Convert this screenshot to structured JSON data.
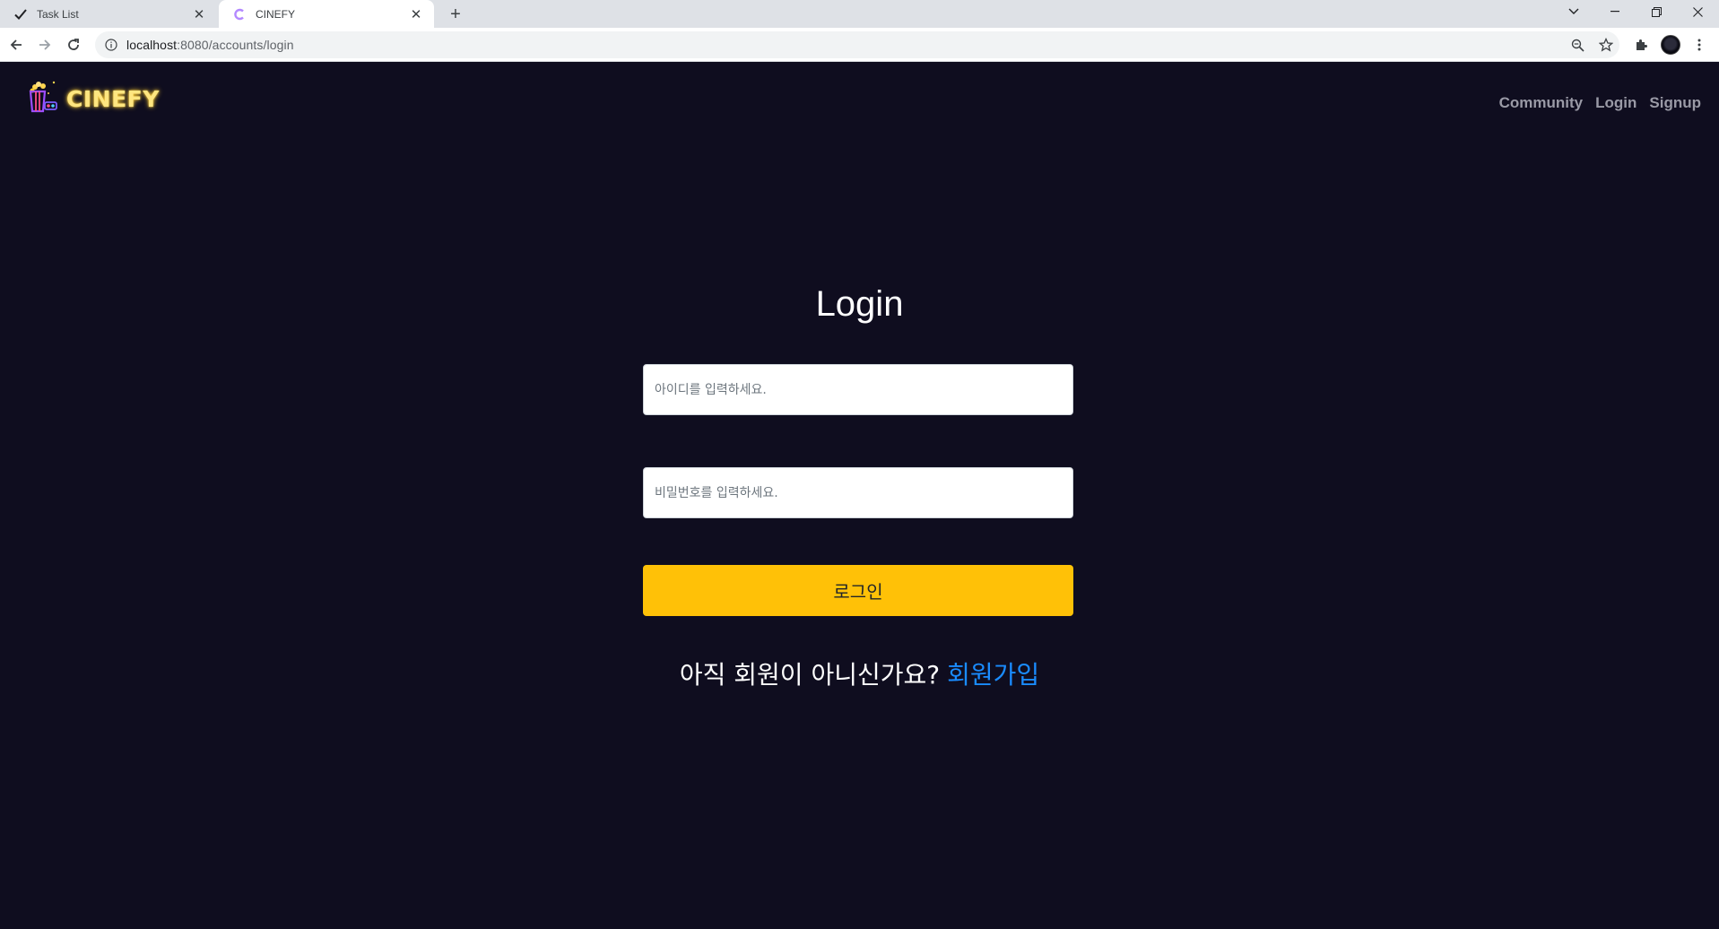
{
  "browser": {
    "tabs": [
      {
        "title": "Task List",
        "active": false,
        "icon": "checkmark-icon"
      },
      {
        "title": "CINEFY",
        "active": true,
        "icon": "cinefy-c-icon"
      }
    ],
    "url_host": "localhost",
    "url_rest": ":8080/accounts/login"
  },
  "header": {
    "logo_text": "CINEFY",
    "nav": {
      "community": "Community",
      "login": "Login",
      "signup": "Signup"
    }
  },
  "login": {
    "title": "Login",
    "username_placeholder": "아이디를 입력하세요.",
    "password_placeholder": "비밀번호를 입력하세요.",
    "submit_label": "로그인",
    "signup_prompt": "아직 회원이 아니신가요?",
    "signup_link": "회원가입"
  },
  "colors": {
    "background": "#0f0d1f",
    "button": "#ffc107",
    "link": "#1a8cff",
    "logo": "#ffe680"
  }
}
